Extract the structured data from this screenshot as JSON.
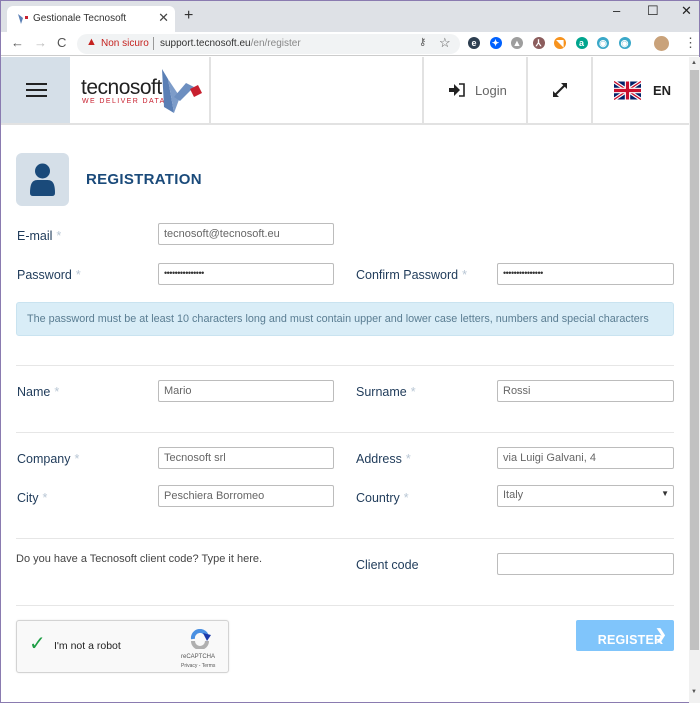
{
  "browser": {
    "tab_title": "Gestionale Tecnosoft",
    "tab_close": "✕",
    "new_tab": "+",
    "window_controls": {
      "minimize": "–",
      "maximize": "☐",
      "close": "✕"
    },
    "nav": {
      "back": "←",
      "forward": "→",
      "reload": "C"
    },
    "omnibox": {
      "security_label": "Non sicuro",
      "url_host": "support.tecnosoft.eu",
      "url_path": "/en/register"
    },
    "extensions": [
      {
        "name": "ext-e",
        "glyph": "e",
        "color": "#2d3e50"
      },
      {
        "name": "dropbox",
        "glyph": "✦",
        "color": "#0061fe"
      },
      {
        "name": "drive",
        "glyph": "▲",
        "color": "#9e9e9e"
      },
      {
        "name": "pdf",
        "glyph": "⅄",
        "color": "#8b5c5c"
      },
      {
        "name": "rss",
        "glyph": "◥",
        "color": "#f7931e"
      },
      {
        "name": "ext-a",
        "glyph": "a",
        "color": "#00a58e"
      },
      {
        "name": "ext-eye-1",
        "glyph": "◉",
        "color": "#3aa8c9"
      },
      {
        "name": "ext-eye-2",
        "glyph": "◉",
        "color": "#3aa8c9"
      }
    ]
  },
  "header": {
    "logo_text": "tecnosoft",
    "logo_tagline": "WE DELIVER DATA",
    "login_label": "Login",
    "language_label": "EN"
  },
  "form": {
    "title": "REGISTRATION",
    "required_mark": "*",
    "email": {
      "label": "E-mail",
      "value": "tecnosoft@tecnosoft.eu"
    },
    "password": {
      "label": "Password",
      "value": "•••••••••••••••"
    },
    "confirm_password": {
      "label": "Confirm Password",
      "value": "•••••••••••••••"
    },
    "password_info": "The password must be at least 10 characters long and must contain upper and lower case letters, numbers and special characters",
    "name": {
      "label": "Name",
      "value": "Mario"
    },
    "surname": {
      "label": "Surname",
      "value": "Rossi"
    },
    "company": {
      "label": "Company",
      "value": "Tecnosoft srl"
    },
    "address": {
      "label": "Address",
      "value": "via Luigi Galvani, 4"
    },
    "city": {
      "label": "City",
      "value": "Peschiera Borromeo"
    },
    "country": {
      "label": "Country",
      "value": "Italy"
    },
    "client_code_hint": "Do you have a Tecnosoft client code? Type it here.",
    "client_code": {
      "label": "Client code",
      "value": ""
    },
    "captcha": {
      "label": "I'm not a robot",
      "brand": "reCAPTCHA",
      "links": "Privacy - Terms",
      "checked": true
    },
    "register_label": "REGISTER"
  },
  "colors": {
    "accent": "#1a4a7a",
    "register_button": "#80c5fb",
    "info_bg": "#d9edf7",
    "hamburger_bg": "#d5dfe8",
    "brand_red": "#c8202f"
  }
}
